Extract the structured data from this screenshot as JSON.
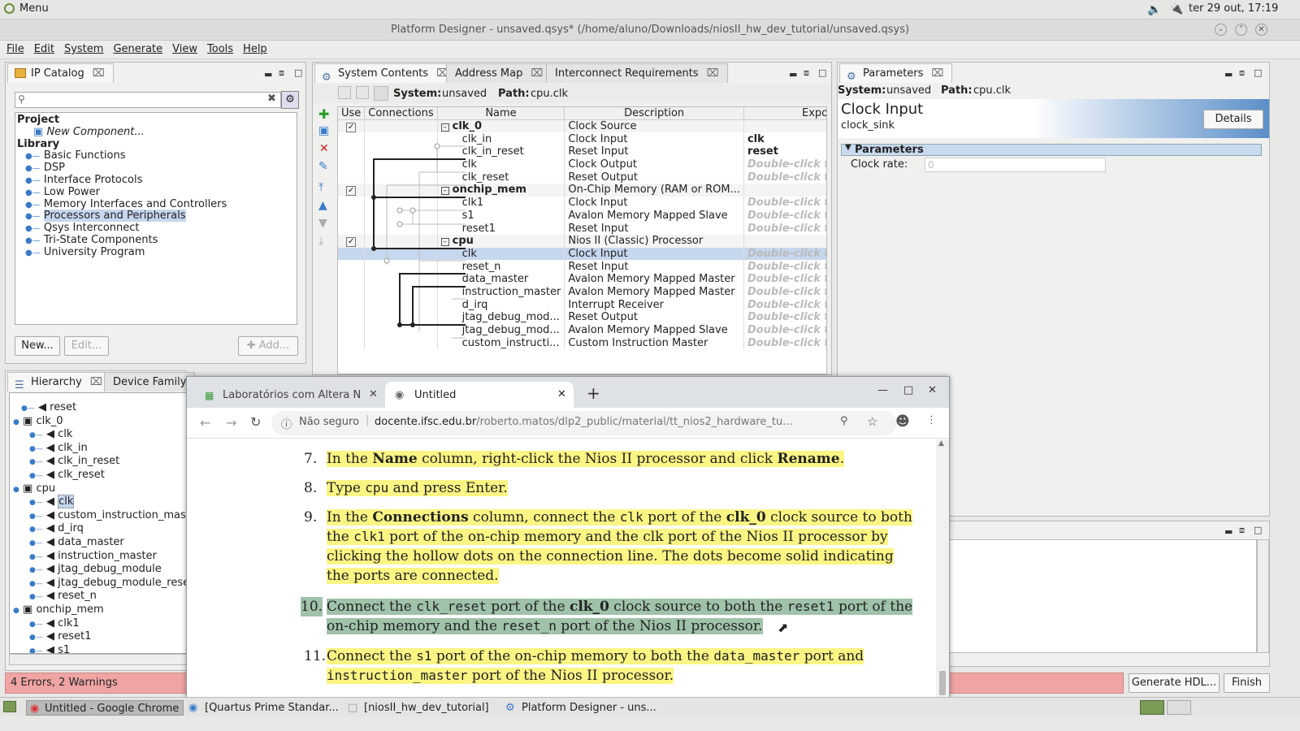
{
  "topbar": {
    "menu": "Menu",
    "clock": "ter 29 out, 17:19"
  },
  "window": {
    "title": "Platform Designer - unsaved.qsys* (/home/aluno/Downloads/niosII_hw_dev_tutorial/unsaved.qsys)"
  },
  "menubar": [
    "File",
    "Edit",
    "System",
    "Generate",
    "View",
    "Tools",
    "Help"
  ],
  "ip_catalog": {
    "tab": "IP Catalog",
    "search_placeholder": "",
    "tree": [
      {
        "label": "Project",
        "bold": true,
        "indent": 0
      },
      {
        "label": "New Component...",
        "italic": true,
        "indent": 2
      },
      {
        "label": "Library",
        "bold": true,
        "indent": 0
      },
      {
        "label": "Basic Functions",
        "indent": 1
      },
      {
        "label": "DSP",
        "indent": 1
      },
      {
        "label": "Interface Protocols",
        "indent": 1
      },
      {
        "label": "Low Power",
        "indent": 1
      },
      {
        "label": "Memory Interfaces and Controllers",
        "indent": 1
      },
      {
        "label": "Processors and Peripherals",
        "indent": 1,
        "selected": true
      },
      {
        "label": "Qsys Interconnect",
        "indent": 1
      },
      {
        "label": "Tri-State Components",
        "indent": 1
      },
      {
        "label": "University Program",
        "indent": 1
      }
    ],
    "new_btn": "New...",
    "edit_btn": "Edit...",
    "add_btn": "Add..."
  },
  "system_contents": {
    "tabs": [
      "System Contents",
      "Address Map",
      "Interconnect Requirements"
    ],
    "system_label": "System:",
    "system_value": "unsaved",
    "path_label": "Path:",
    "path_value": "cpu.clk",
    "headers": [
      "Use",
      "Connections",
      "Name",
      "Description",
      "Export"
    ],
    "rows": [
      {
        "use": true,
        "name": "clk_0",
        "group": true,
        "desc": "Clock Source",
        "export": ""
      },
      {
        "name": "clk_in",
        "desc": "Clock Input",
        "export": "clk",
        "exb": true
      },
      {
        "name": "clk_in_reset",
        "desc": "Reset Input",
        "export": "reset",
        "exb": true
      },
      {
        "name": "clk",
        "desc": "Clock Output",
        "export": "Double-click to"
      },
      {
        "name": "clk_reset",
        "desc": "Reset Output",
        "export": "Double-click to"
      },
      {
        "use": true,
        "name": "onchip_mem",
        "group": true,
        "desc": "On-Chip Memory (RAM or ROM...",
        "export": ""
      },
      {
        "name": "clk1",
        "desc": "Clock Input",
        "export": "Double-click to"
      },
      {
        "name": "s1",
        "desc": "Avalon Memory Mapped Slave",
        "export": "Double-click to"
      },
      {
        "name": "reset1",
        "desc": "Reset Input",
        "export": "Double-click to"
      },
      {
        "use": true,
        "name": "cpu",
        "group": true,
        "desc": "Nios II (Classic) Processor",
        "export": ""
      },
      {
        "name": "clk",
        "desc": "Clock Input",
        "export": "Double-click to",
        "selected": true
      },
      {
        "name": "reset_n",
        "desc": "Reset Input",
        "export": "Double-click to"
      },
      {
        "name": "data_master",
        "desc": "Avalon Memory Mapped Master",
        "export": "Double-click to"
      },
      {
        "name": "instruction_master",
        "desc": "Avalon Memory Mapped Master",
        "export": "Double-click to"
      },
      {
        "name": "d_irq",
        "desc": "Interrupt Receiver",
        "export": "Double-click to"
      },
      {
        "name": "jtag_debug_mod...",
        "desc": "Reset Output",
        "export": "Double-click to"
      },
      {
        "name": "jtag_debug_mod...",
        "desc": "Avalon Memory Mapped Slave",
        "export": "Double-click to"
      },
      {
        "name": "custom_instructi...",
        "desc": "Custom Instruction Master",
        "export": "Double-click to"
      }
    ]
  },
  "parameters": {
    "tab": "Parameters",
    "system_label": "System:",
    "system_value": "unsaved",
    "path_label": "Path:",
    "path_value": "cpu.clk",
    "title": "Clock Input",
    "subtitle": "clock_sink",
    "details_btn": "Details",
    "section": "Parameters",
    "clock_rate_label": "Clock rate:",
    "clock_rate_value": "0"
  },
  "hierarchy": {
    "tabs": [
      "Hierarchy",
      "Device Family"
    ],
    "tree": [
      {
        "label": "reset",
        "indent": 1
      },
      {
        "label": "clk_0",
        "indent": 0,
        "group": true
      },
      {
        "label": "clk",
        "indent": 2
      },
      {
        "label": "clk_in",
        "indent": 2
      },
      {
        "label": "clk_in_reset",
        "indent": 2
      },
      {
        "label": "clk_reset",
        "indent": 2
      },
      {
        "label": "cpu",
        "indent": 0,
        "group": true
      },
      {
        "label": "clk",
        "indent": 2,
        "selected": true
      },
      {
        "label": "custom_instruction_maste",
        "indent": 2
      },
      {
        "label": "d_irq",
        "indent": 2
      },
      {
        "label": "data_master",
        "indent": 2
      },
      {
        "label": "instruction_master",
        "indent": 2
      },
      {
        "label": "jtag_debug_module",
        "indent": 2
      },
      {
        "label": "jtag_debug_module_reset",
        "indent": 2
      },
      {
        "label": "reset_n",
        "indent": 2
      },
      {
        "label": "onchip_mem",
        "indent": 0,
        "group": true
      },
      {
        "label": "clk1",
        "indent": 2
      },
      {
        "label": "reset1",
        "indent": 2
      },
      {
        "label": "s1",
        "indent": 2
      }
    ]
  },
  "status": {
    "errors": "4 Errors, 2 Warnings",
    "generate_btn": "Generate HDL...",
    "finish_btn": "Finish"
  },
  "browser": {
    "tabs": [
      "Laboratórios com Altera NI",
      "Untitled"
    ],
    "security": "Não seguro",
    "url_host": "docente.ifsc.edu.br",
    "url_path": "/roberto.matos/dlp2_public/material/tt_nios2_hardware_tu..."
  },
  "doc": {
    "s7": {
      "num": "7.",
      "a": "In the ",
      "b": "Name",
      "c": " column, right-click the Nios II processor and click ",
      "d": "Rename",
      "e": "."
    },
    "s8": {
      "num": "8.",
      "a": "Type ",
      "b": "cpu",
      "c": " and press Enter."
    },
    "s9": {
      "num": "9.",
      "l1a": "In the ",
      "l1b": "Connections",
      "l1c": " column, connect the ",
      "l1d": "clk",
      "l1e": " port of the ",
      "l1f": "clk_0",
      "l1g": " clock source to both",
      "l2a": "the ",
      "l2b": "clk1",
      "l2c": " port of the on-chip memory and the clk port of the Nios II processor by",
      "l3": "clicking the hollow dots on the connection line. The dots become solid indicating",
      "l4": "the ports are connected."
    },
    "s10": {
      "num": "10.",
      "l1a": "Connect the ",
      "l1b": "clk_reset",
      "l1c": " port of the ",
      "l1d": "clk_0",
      "l1e": " clock source to both the ",
      "l1f": "reset1",
      "l1g": " port of the",
      "l2a": "on-chip memory and the ",
      "l2b": "reset_n",
      "l2c": " port of the Nios II processor."
    },
    "s11": {
      "num": "11.",
      "l1a": "Connect the ",
      "l1b": "s1",
      "l1c": " port of the on-chip memory to both the ",
      "l1d": "data_master",
      "l1e": " port and",
      "l2a": "instruction_master",
      "l2b": " port of the Nios II processor."
    }
  },
  "taskbar": [
    "Untitled - Google Chrome",
    "[Quartus Prime Standar...",
    "[niosII_hw_dev_tutorial]",
    "Platform Designer - uns..."
  ],
  "colors": {
    "highlight": "#fbf584",
    "selection": "#c6d7ee",
    "error": "#f0a4a4"
  }
}
